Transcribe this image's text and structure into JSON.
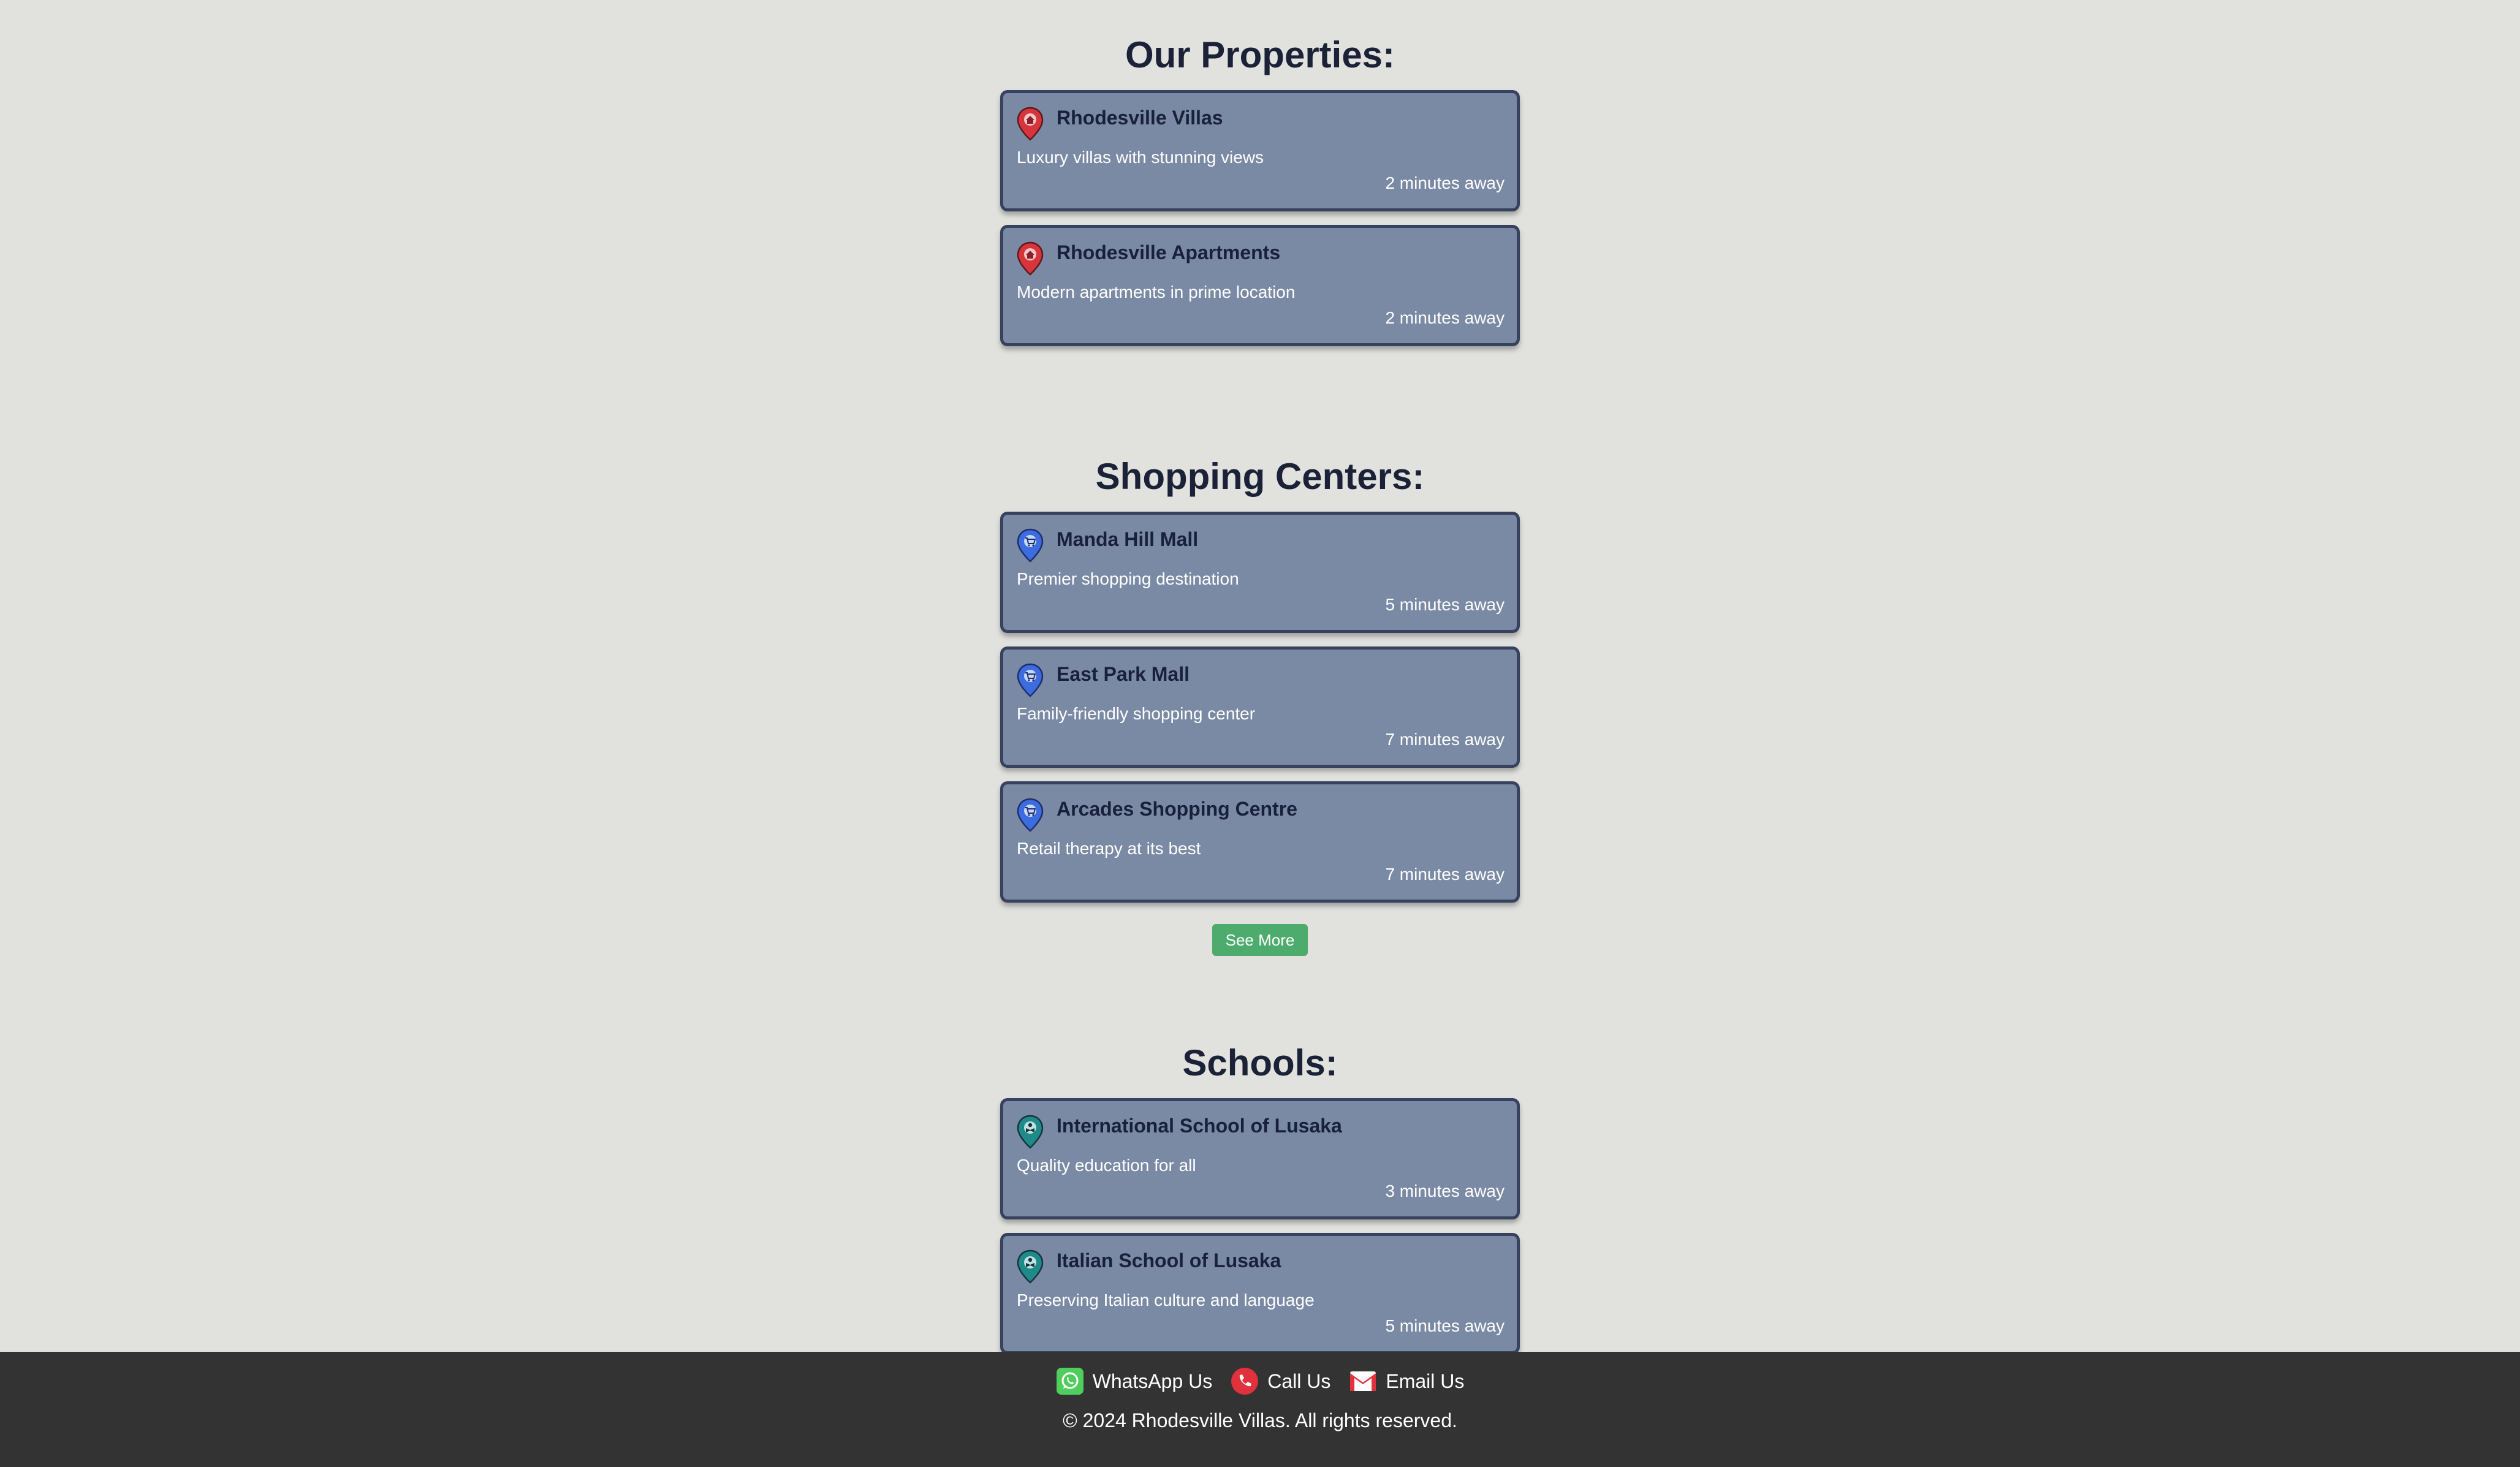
{
  "sections": [
    {
      "title": "Our Properties:",
      "pin_color": "#d8343c",
      "icon": "home-location-pin-icon",
      "items": [
        {
          "name": "Rhodesville Villas",
          "description": "Luxury villas with stunning views",
          "distance": "2 minutes away"
        },
        {
          "name": "Rhodesville Apartments",
          "description": "Modern apartments in prime location",
          "distance": "2 minutes away"
        }
      ]
    },
    {
      "title": "Shopping Centers:",
      "pin_color": "#3d6be0",
      "icon": "shopping-cart-location-pin-icon",
      "items": [
        {
          "name": "Manda Hill Mall",
          "description": "Premier shopping destination",
          "distance": "5 minutes away"
        },
        {
          "name": "East Park Mall",
          "description": "Family-friendly shopping center",
          "distance": "7 minutes away"
        },
        {
          "name": "Arcades Shopping Centre",
          "description": "Retail therapy at its best",
          "distance": "7 minutes away"
        }
      ],
      "see_more_label": "See More"
    },
    {
      "title": "Schools:",
      "pin_color": "#1f8a8a",
      "icon": "school-location-pin-icon",
      "items": [
        {
          "name": "International School of Lusaka",
          "description": "Quality education for all",
          "distance": "3 minutes away"
        },
        {
          "name": "Italian School of Lusaka",
          "description": "Preserving Italian culture and language",
          "distance": "5 minutes away"
        }
      ]
    }
  ],
  "footer": {
    "whatsapp_label": "WhatsApp Us",
    "call_label": "Call Us",
    "email_label": "Email Us",
    "copyright": "© 2024 Rhodesville Villas. All rights reserved.",
    "whatsapp_color": "#4fce5d",
    "call_color": "#e0313c",
    "email_color": "#e0313c"
  }
}
